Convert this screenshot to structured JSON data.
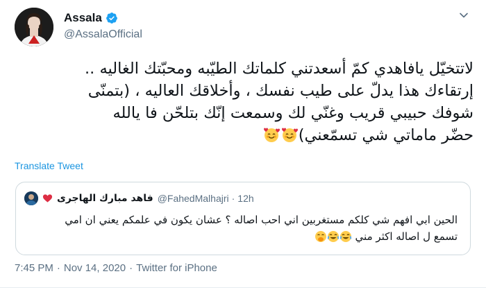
{
  "tweet": {
    "author": {
      "display_name": "Assala",
      "handle": "@AssalaOfficial",
      "verified": true,
      "verified_icon": "verified-badge-icon",
      "verified_color": "#1da1f2"
    },
    "menu_icon": "chevron-down-icon",
    "body_lines": [
      "لاتتخيّل يافاهدي كمّ أسعدتني كلماتك الطيّبه ومحبّتك الغاليه ..",
      "إرتقاءك هذا يدلّ على طيب نفسك ، وأخلاقك العاليه ، (بتمنّى",
      "شوفك حبيبي قريب وغنّي لك وسمعت إنّك بتلحّن فا يالله",
      "حضّر ماماتي شي تسمّعني)"
    ],
    "body_emoji": [
      "smiling-face-with-hearts",
      "smiling-face-with-hearts"
    ],
    "translate_label": "Translate Tweet",
    "link_color": "#1b95e0",
    "quoted": {
      "author_name": "فاهد مبارك الهاجرى",
      "heart_icon": "red-heart-icon",
      "handle": "@FahedMalhajri",
      "dot": "·",
      "time": "12h",
      "text_lines": [
        "الحين ابي افهم شي كلكم مستغربين اني احب اصاله ؟ عشان يكون في علمكم يعني ان امي",
        "تسمع ل اصاله اكثر مني"
      ],
      "text_emoji": [
        "face-with-tears-of-joy",
        "face-with-tears-of-joy",
        "face-with-hand-over-mouth"
      ]
    },
    "meta": {
      "time": "7:45 PM",
      "sep1": "·",
      "date": "Nov 14, 2020",
      "sep2": "·",
      "source": "Twitter for iPhone"
    }
  }
}
